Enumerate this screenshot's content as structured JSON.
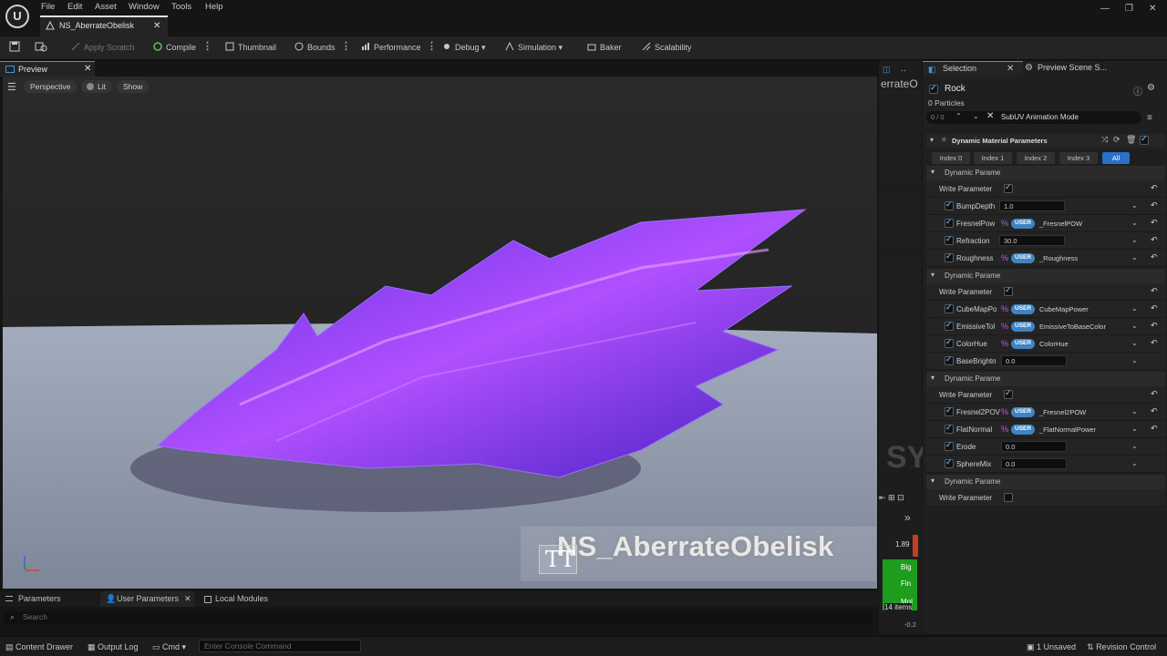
{
  "app": {
    "logo_glyph": "U",
    "menu": [
      "File",
      "Edit",
      "Asset",
      "Window",
      "Tools",
      "Help"
    ],
    "asset_tab": "NS_AberrateObelisk",
    "window_controls": [
      "—",
      "❐",
      "✕"
    ]
  },
  "toolbar": {
    "apply_scratch": "Apply Scratch",
    "compile": "Compile",
    "thumbnail": "Thumbnail",
    "bounds": "Bounds",
    "performance": "Performance",
    "debug": "Debug",
    "simulation": "Simulation",
    "baker": "Baker",
    "scalability": "Scalability"
  },
  "preview": {
    "tab_label": "Preview",
    "perspective": "Perspective",
    "lit": "Lit",
    "show": "Show",
    "overlay_title": "NS_AberrateObelisk",
    "overlay_icon": "TT"
  },
  "bottom": {
    "tabs": [
      "Parameters",
      "User Parameters",
      "Local Modules"
    ],
    "search_placeholder": "Search"
  },
  "statusbar": {
    "content_drawer": "Content Drawer",
    "output_log": "Output Log",
    "cmd": "Cmd",
    "console_placeholder": "Enter Console Command",
    "unsaved": "1 Unsaved",
    "revision_control": "Revision Control"
  },
  "midstrip": {
    "partial_label": "errateO",
    "big_letters": "SY",
    "value": "1.89",
    "items": [
      "Big",
      "Fin",
      "Mol"
    ],
    "count": "14 items",
    "bottom_value": "-0.2"
  },
  "selection": {
    "tab_label": "Selection",
    "scene_tab": "Preview Scene S...",
    "emitter": "Rock",
    "particles": "0 Particles",
    "counter": "0 / 0",
    "search_value": "SubUV Animation Mode",
    "section_title": "Dynamic Material Parameters",
    "index_buttons": [
      "Index 0",
      "Index 1",
      "Index 2",
      "Index 3",
      "All"
    ],
    "active_index": "All",
    "groups": [
      {
        "header": "Dynamic Parame",
        "write_label": "Write Parameter",
        "write_checked": true,
        "rows": [
          {
            "name": "BumpDepth",
            "type": "value",
            "value": "1.0"
          },
          {
            "name": "FresnelPow",
            "type": "user",
            "pill": "USER",
            "ref": "_FresnelPOW"
          },
          {
            "name": "Refraction",
            "type": "value",
            "value": "30.0"
          },
          {
            "name": "Roughness",
            "type": "user",
            "pill": "USER",
            "ref": "_Roughness"
          }
        ]
      },
      {
        "header": "Dynamic Parame",
        "write_label": "Write Parameter",
        "write_checked": true,
        "rows": [
          {
            "name": "CubeMapPo",
            "type": "user",
            "pill": "USER",
            "ref": "CubeMapPower"
          },
          {
            "name": "EmissiveTol",
            "type": "user",
            "pill": "USER",
            "ref": "EmissiveToBaseColor"
          },
          {
            "name": "ColorHue",
            "type": "user",
            "pill": "USER",
            "ref": "ColorHue"
          },
          {
            "name": "BaseBrightn",
            "type": "value",
            "value": "0.0"
          }
        ]
      },
      {
        "header": "Dynamic Parame",
        "write_label": "Write Parameter",
        "write_checked": true,
        "rows": [
          {
            "name": "Fresnel2POV",
            "type": "user",
            "pill": "USER",
            "ref": "_Fresnel2POW"
          },
          {
            "name": "FlatNormal",
            "type": "user",
            "pill": "USER",
            "ref": "_FlatNormalPower"
          },
          {
            "name": "Erode",
            "type": "value",
            "value": "0.0"
          },
          {
            "name": "SphereMix",
            "type": "value",
            "value": "0.0"
          }
        ]
      },
      {
        "header": "Dynamic Parame",
        "write_label": "Write Parameter",
        "write_checked": false,
        "rows": []
      }
    ]
  },
  "colors": {
    "accent": "#3f84c2",
    "crystal": "#7a3cf0",
    "floor": "#9aa3b3"
  }
}
